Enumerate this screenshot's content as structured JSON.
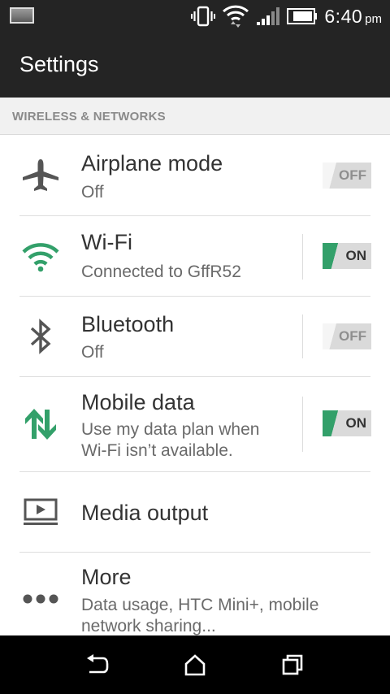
{
  "status_bar": {
    "time": "6:40",
    "ampm": "pm",
    "icons": [
      "screenshot-thumbnail-icon",
      "vibrate-icon",
      "wifi-data-icon",
      "signal-icon",
      "battery-icon"
    ]
  },
  "app_bar": {
    "title": "Settings"
  },
  "section": {
    "title": "WIRELESS & NETWORKS"
  },
  "rows": [
    {
      "title": "Airplane mode",
      "subtitle": "Off",
      "toggle": "OFF",
      "icon": "airplane-icon"
    },
    {
      "title": "Wi-Fi",
      "subtitle": "Connected to GffR52",
      "toggle": "ON",
      "icon": "wifi-icon"
    },
    {
      "title": "Bluetooth",
      "subtitle": "Off",
      "toggle": "OFF",
      "icon": "bluetooth-icon"
    },
    {
      "title": "Mobile data",
      "subtitle_line1": "Use my data plan when",
      "subtitle_line2": "Wi-Fi isn’t available.",
      "toggle": "ON",
      "icon": "mobile-data-icon"
    },
    {
      "title": "Media output",
      "icon": "media-output-icon"
    },
    {
      "title": "More",
      "subtitle_line1": "Data usage, HTC Mini+, mobile",
      "subtitle_line2": "network sharing...",
      "icon": "more-icon"
    }
  ],
  "nav_bar": {
    "icons": [
      "back-icon",
      "home-icon",
      "recents-icon"
    ]
  },
  "colors": {
    "accent_green": "#33a06a",
    "icon_gray": "#555555",
    "bar_dark": "#242424"
  }
}
